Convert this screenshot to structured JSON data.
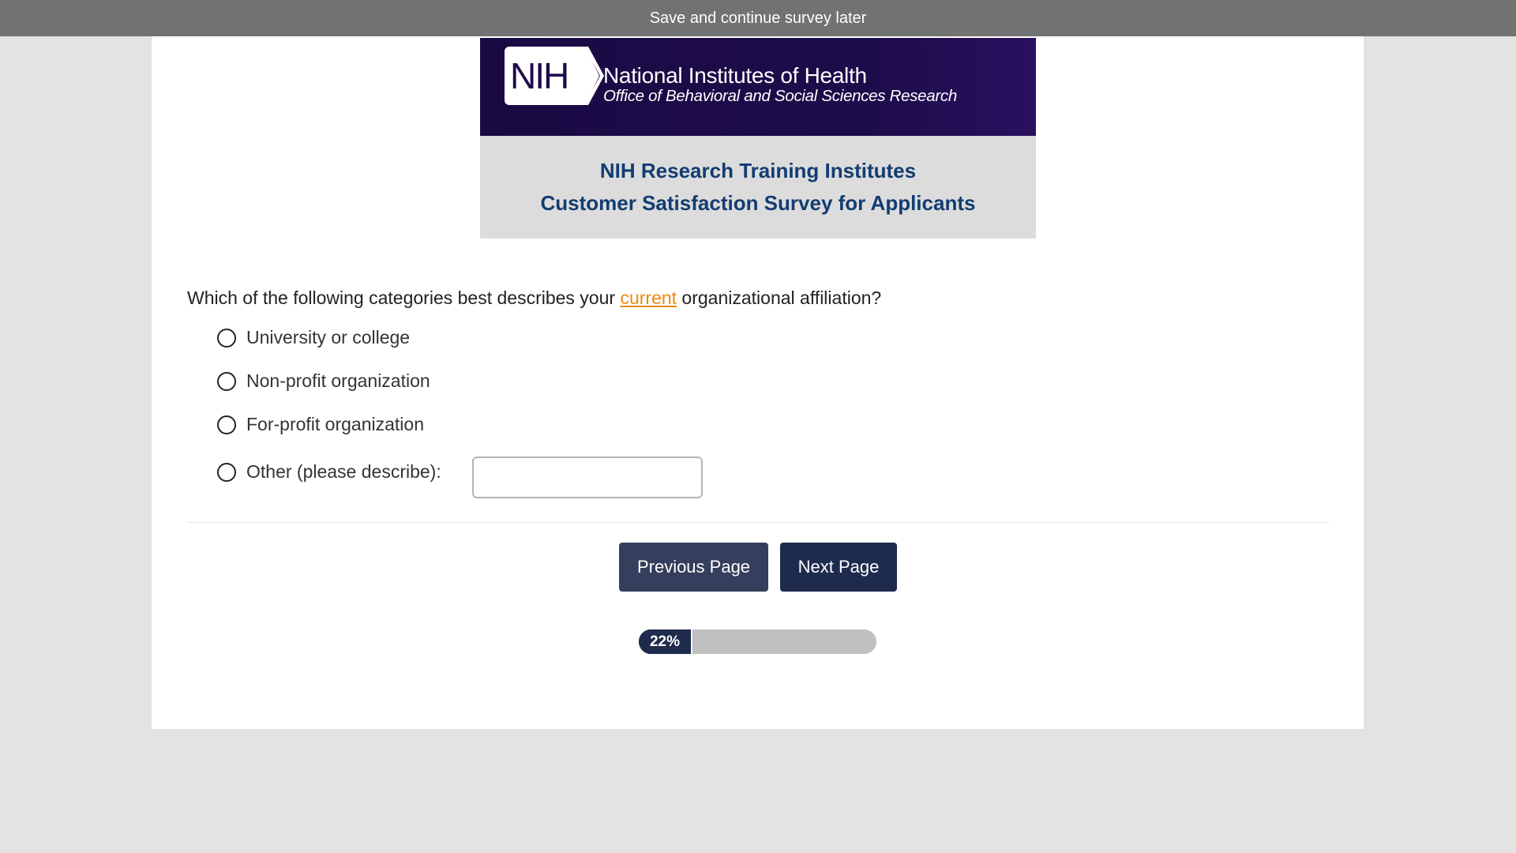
{
  "top_bar": {
    "save_label": "Save and continue survey later"
  },
  "header": {
    "logo_text": "NIH",
    "org_name": "National Institutes of Health",
    "office_name": "Office of Behavioral and Social Sciences Research",
    "title_line1": "NIH Research Training Institutes",
    "title_line2": "Customer Satisfaction Survey for Applicants"
  },
  "question": {
    "text_before": "Which of the following categories best describes your ",
    "highlight": "current",
    "text_after": " organizational affiliation?",
    "options": [
      {
        "label": "University or college"
      },
      {
        "label": "Non-profit organization"
      },
      {
        "label": "For-profit organization"
      },
      {
        "label": "Other (please describe):"
      }
    ],
    "other_value": ""
  },
  "navigation": {
    "previous_label": "Previous Page",
    "next_label": "Next Page"
  },
  "progress": {
    "label": "22%",
    "value": 0.22
  },
  "colors": {
    "top_bar": "#727272",
    "banner": "#1d0c4a",
    "title_text": "#123c72",
    "highlight": "#ef8a0e",
    "button_dark": "#1f2b4d",
    "progress_track": "#c0c0c0"
  }
}
